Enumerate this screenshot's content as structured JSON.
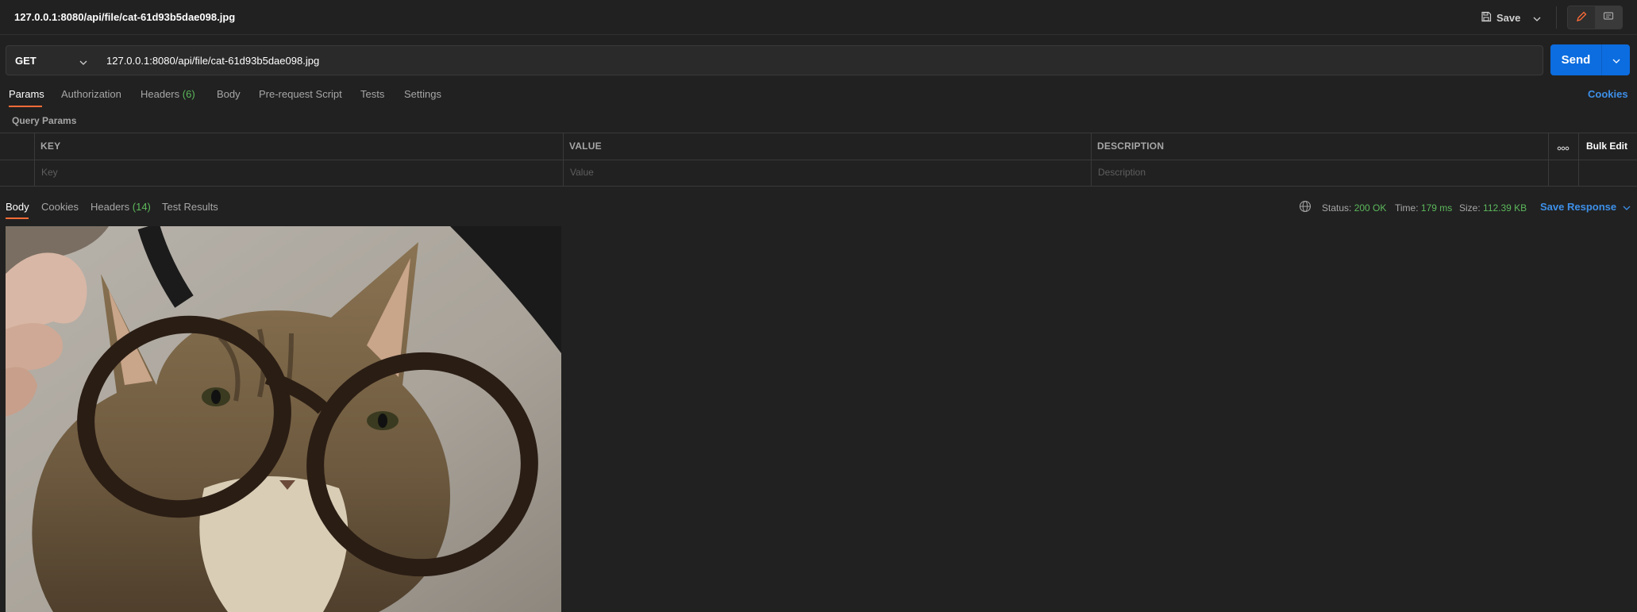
{
  "titlebar": {
    "title": "127.0.0.1:8080/api/file/cat-61d93b5dae098.jpg",
    "save_label": "Save"
  },
  "request": {
    "method": "GET",
    "url": "127.0.0.1:8080/api/file/cat-61d93b5dae098.jpg",
    "send_label": "Send"
  },
  "request_tabs": [
    {
      "label": "Params",
      "active": true
    },
    {
      "label": "Authorization"
    },
    {
      "label": "Headers",
      "count": "(6)"
    },
    {
      "label": "Body"
    },
    {
      "label": "Pre-request Script"
    },
    {
      "label": "Tests"
    },
    {
      "label": "Settings"
    }
  ],
  "cookies_link": "Cookies",
  "query_params": {
    "label": "Query Params",
    "columns": {
      "key": "KEY",
      "value": "VALUE",
      "description": "DESCRIPTION"
    },
    "placeholders": {
      "key": "Key",
      "value": "Value",
      "description": "Description"
    },
    "bulk_edit": "Bulk Edit"
  },
  "response_tabs": [
    {
      "label": "Body",
      "active": true
    },
    {
      "label": "Cookies"
    },
    {
      "label": "Headers",
      "count": "(14)"
    },
    {
      "label": "Test Results"
    }
  ],
  "response_meta": {
    "status_label": "Status:",
    "status": "200 OK",
    "time_label": "Time:",
    "time": "179 ms",
    "size_label": "Size:",
    "size": "112.39 KB",
    "save_response": "Save Response"
  },
  "response_body": {
    "image_description": "cat wearing glasses"
  },
  "colors": {
    "accent_orange": "#ff6c37",
    "send_blue": "#0c6de0",
    "link_blue": "#3d8fe8",
    "status_green": "#5cb85c",
    "background": "#212121"
  },
  "icons": [
    "save-icon",
    "chevron-down-icon",
    "edit-icon",
    "comment-icon",
    "globe-icon",
    "more-icon"
  ]
}
